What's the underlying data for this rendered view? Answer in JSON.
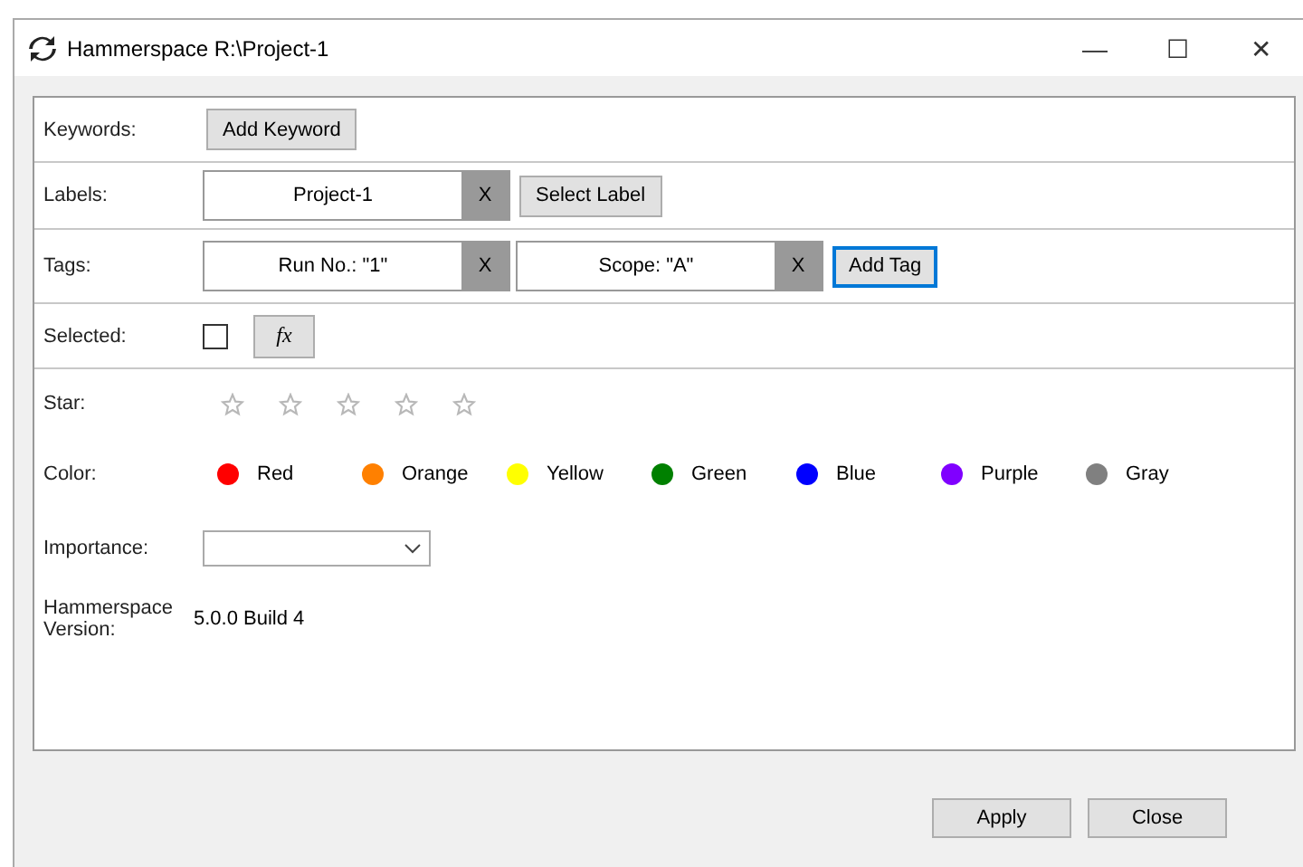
{
  "window": {
    "title": "Hammerspace R:\\Project-1",
    "controls": [
      "—",
      "☐",
      "✕"
    ]
  },
  "keywords": {
    "label": "Keywords:",
    "button": "Add Keyword"
  },
  "labels": {
    "label": "Labels:",
    "items": [
      {
        "text": "Project-1",
        "remove": "X"
      }
    ],
    "button": "Select Label"
  },
  "tags": {
    "label": "Tags:",
    "items": [
      {
        "text": "Run No.: \"1\"",
        "remove": "X"
      },
      {
        "text": "Scope: \"A\"",
        "remove": "X"
      }
    ],
    "button": "Add Tag"
  },
  "selected": {
    "label": "Selected:",
    "checked": false,
    "fx": "fx"
  },
  "star": {
    "label": "Star:",
    "stars": 0
  },
  "color": {
    "label": "Color:",
    "options": [
      {
        "name": "Red",
        "color": "#ff0000"
      },
      {
        "name": "Orange",
        "color": "#ff8000"
      },
      {
        "name": "Yellow",
        "color": "#ffff00"
      },
      {
        "name": "Green",
        "color": "#008000"
      },
      {
        "name": "Blue",
        "color": "#0000ff"
      },
      {
        "name": "Purple",
        "color": "#8000ff"
      },
      {
        "name": "Gray",
        "color": "#808080"
      }
    ]
  },
  "importance": {
    "label": "Importance:"
  },
  "version": {
    "label": "Hammerspace Version:",
    "value": "5.0.0 Build 4"
  },
  "buttons": [
    "Apply",
    "Close"
  ]
}
